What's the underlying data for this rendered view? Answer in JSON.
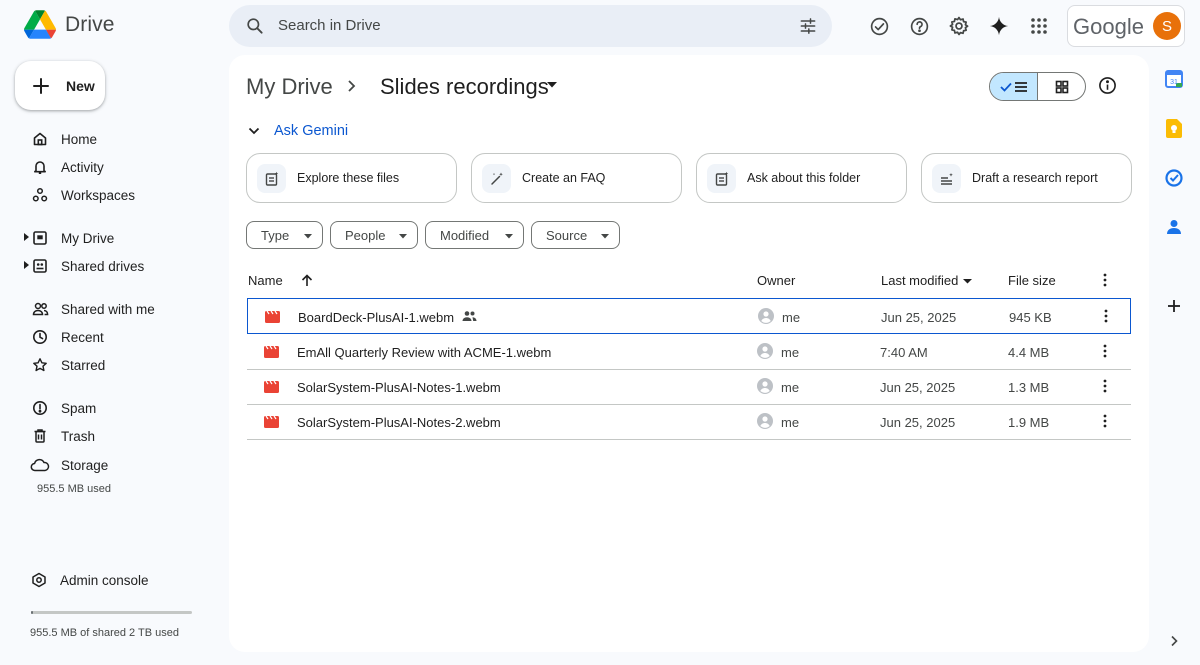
{
  "app": {
    "name": "Drive"
  },
  "search": {
    "placeholder": "Search in Drive"
  },
  "account": {
    "brand": "Google",
    "initial": "S",
    "avatar_color": "#e8710a"
  },
  "sidebar": {
    "new_label": "New",
    "items": [
      {
        "label": "Home",
        "icon": "home-icon"
      },
      {
        "label": "Activity",
        "icon": "bell-icon"
      },
      {
        "label": "Workspaces",
        "icon": "workspaces-icon"
      },
      {
        "label": "My Drive",
        "icon": "my-drive-icon"
      },
      {
        "label": "Shared drives",
        "icon": "shared-drives-icon"
      },
      {
        "label": "Shared with me",
        "icon": "people-icon"
      },
      {
        "label": "Recent",
        "icon": "clock-icon"
      },
      {
        "label": "Starred",
        "icon": "star-icon"
      },
      {
        "label": "Spam",
        "icon": "spam-icon"
      },
      {
        "label": "Trash",
        "icon": "trash-icon"
      },
      {
        "label": "Storage",
        "icon": "cloud-icon"
      }
    ],
    "storage_used": "955.5 MB used",
    "admin_label": "Admin console",
    "quota_text": "955.5 MB of shared 2 TB used",
    "quota_fraction": 0.0005
  },
  "breadcrumb": {
    "root": "My Drive",
    "current": "Slides recordings"
  },
  "gemini": {
    "label": "Ask Gemini",
    "cards": [
      {
        "label": "Explore these files"
      },
      {
        "label": "Create an FAQ"
      },
      {
        "label": "Ask about this folder"
      },
      {
        "label": "Draft a research report"
      }
    ]
  },
  "filters": [
    {
      "label": "Type"
    },
    {
      "label": "People"
    },
    {
      "label": "Modified"
    },
    {
      "label": "Source"
    }
  ],
  "table": {
    "columns": {
      "name": "Name",
      "owner": "Owner",
      "modified": "Last modified",
      "size": "File size"
    },
    "rows": [
      {
        "name": "BoardDeck-PlusAI-1.webm",
        "owner": "me",
        "modified": "Jun 25, 2025",
        "size": "945 KB",
        "shared": true
      },
      {
        "name": "EmAll Quarterly Review with ACME-1.webm",
        "owner": "me",
        "modified": "7:40 AM",
        "size": "4.4 MB",
        "shared": false
      },
      {
        "name": "SolarSystem-PlusAI-Notes-1.webm",
        "owner": "me",
        "modified": "Jun 25, 2025",
        "size": "1.3 MB",
        "shared": false
      },
      {
        "name": "SolarSystem-PlusAI-Notes-2.webm",
        "owner": "me",
        "modified": "Jun 25, 2025",
        "size": "1.9 MB",
        "shared": false
      }
    ]
  },
  "colors": {
    "accent": "#0b57d0",
    "video_file": "#ea4335",
    "selected_view": "#c2e7ff"
  }
}
